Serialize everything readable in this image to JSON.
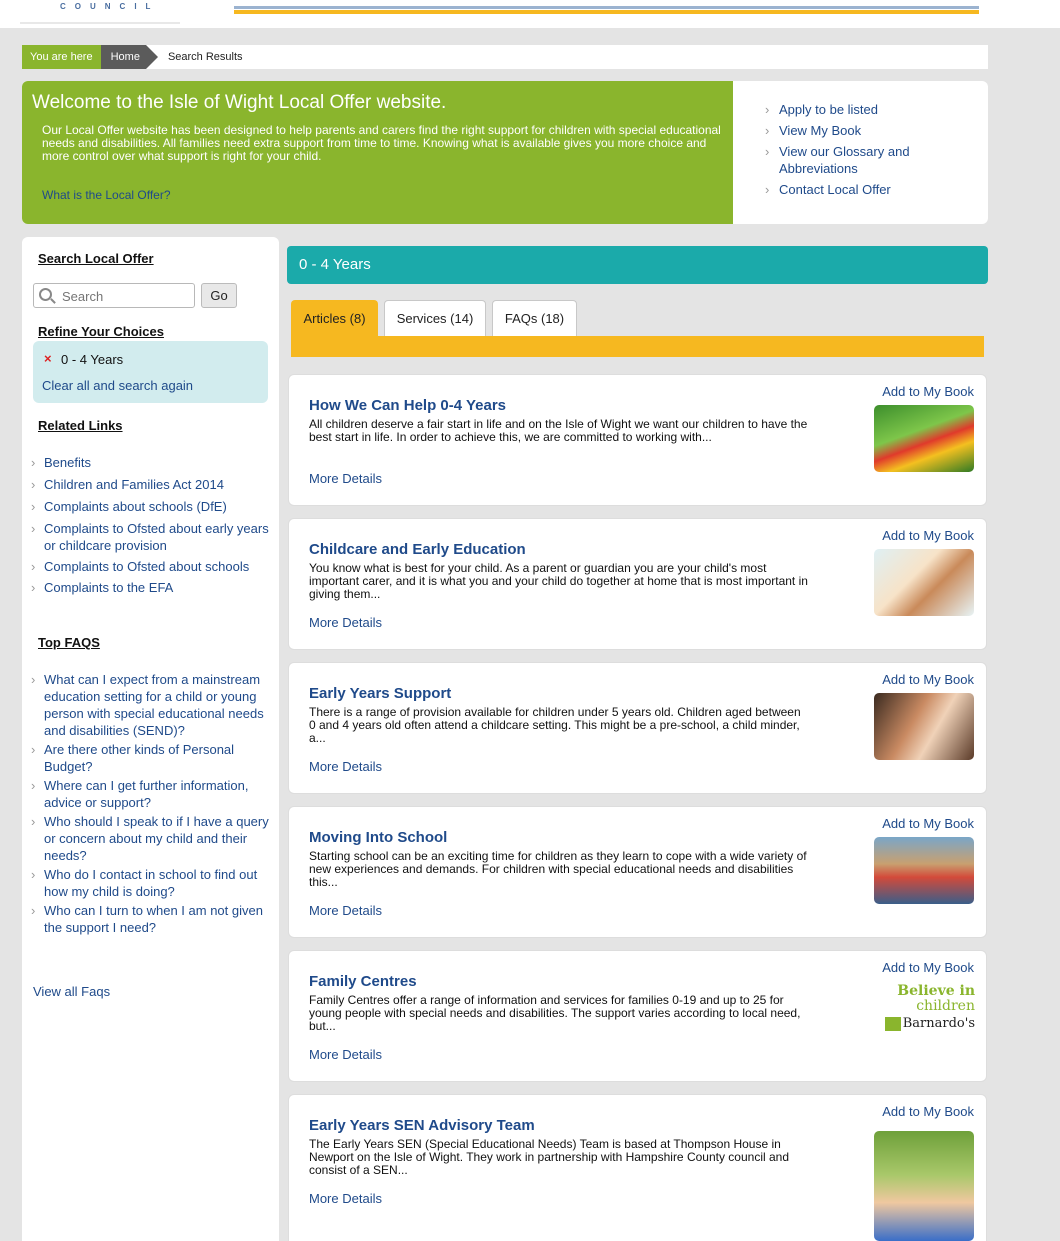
{
  "header": {
    "logo_text": "COUNCIL"
  },
  "breadcrumb": {
    "here": "You are here",
    "home": "Home",
    "current": "Search Results"
  },
  "welcome": {
    "title": "Welcome to the Isle of Wight Local Offer website.",
    "text": "Our Local Offer website has been designed to help parents and carers find the right support for children with special educational needs and disabilities. All families need extra support from time to time. Knowing what is available gives you more choice and more control over what support is right for your child.",
    "link": "What is the Local Offer?",
    "side_links": [
      "Apply to be listed",
      "View My Book",
      "View our Glossary and Abbreviations",
      "Contact Local Offer"
    ]
  },
  "sidebar": {
    "search_heading": "Search Local Offer",
    "search_placeholder": "Search",
    "go_label": "Go",
    "refine_heading": "Refine Your Choices",
    "refine_value": "0 - 4 Years",
    "clear_label": "Clear all and search again",
    "related_heading": "Related Links",
    "related_links": [
      "Benefits",
      "Children and Families Act 2014",
      "Complaints about schools (DfE)",
      "Complaints to Ofsted about early years or childcare provision",
      "Complaints to Ofsted about schools",
      "Complaints to the EFA"
    ],
    "faqs_heading": "Top FAQS",
    "faqs": [
      "What can I expect from a mainstream education setting for a child or young person with special educational needs and disabilities (SEND)?",
      "Are there other kinds of Personal Budget?",
      "Where can I get further information, advice or support?",
      "Who should I speak to if I have a query or concern about my child and their needs?",
      "Who do I contact in school to find out how my child is doing?",
      "Who can I turn to when I am not given the support I need?"
    ],
    "view_all_faqs": "View all Faqs"
  },
  "main": {
    "category": "0 - 4 Years",
    "tabs": [
      {
        "label": "Articles (8)",
        "active": true
      },
      {
        "label": "Services (14)",
        "active": false
      },
      {
        "label": "FAQs (18)",
        "active": false
      }
    ],
    "add_label": "Add to My Book",
    "more_label": "More Details",
    "cards": [
      {
        "title": "How We Can Help 0-4 Years",
        "text": "All children deserve a fair start in life and on the Isle of Wight we want our children to have the best start in life.  In order to achieve this, we are committed to working with...",
        "image": "children-lying-in-grass-photo"
      },
      {
        "title": "Childcare and Early Education",
        "text": "You know what is best for your child. As a parent or guardian you are your child's most important carer, and it is what you and your child do together at home that is most important in giving them...",
        "image": "mother-and-child-drawing-photo"
      },
      {
        "title": "Early Years Support",
        "text": "There is a range of provision available for children under 5 years old. Children aged between 0 and 4 years old often attend a childcare setting. This might be a pre-school, a child minder, a...",
        "image": "mother-holding-baby-photo"
      },
      {
        "title": "Moving Into School",
        "text": "Starting school can be an exciting time for children as they learn to cope with a wide variety of new experiences and demands. For children with special educational needs and disabilities this...",
        "image": "classroom-children-photo"
      },
      {
        "title": "Family Centres",
        "text": "Family Centres offer a range of information and services for families 0-19 and up to 25 for young people with special needs and disabilities. The support varies according to local need, but...",
        "logo": {
          "line1": "Believe in",
          "line2": "children",
          "line3": "Barnardo's"
        }
      },
      {
        "title": "Early Years SEN Advisory Team",
        "text": "The Early Years SEN (Special Educational Needs) Team is  based at Thompson House in Newport on the Isle of Wight. They work in partnership with Hampshire County council and consist of a SEN...",
        "image": "smiling-toddler-photo"
      }
    ]
  },
  "colors": {
    "green": "#8ab52d",
    "teal": "#1baaaa",
    "yellow": "#f6b820",
    "link": "#1f4a8a"
  }
}
